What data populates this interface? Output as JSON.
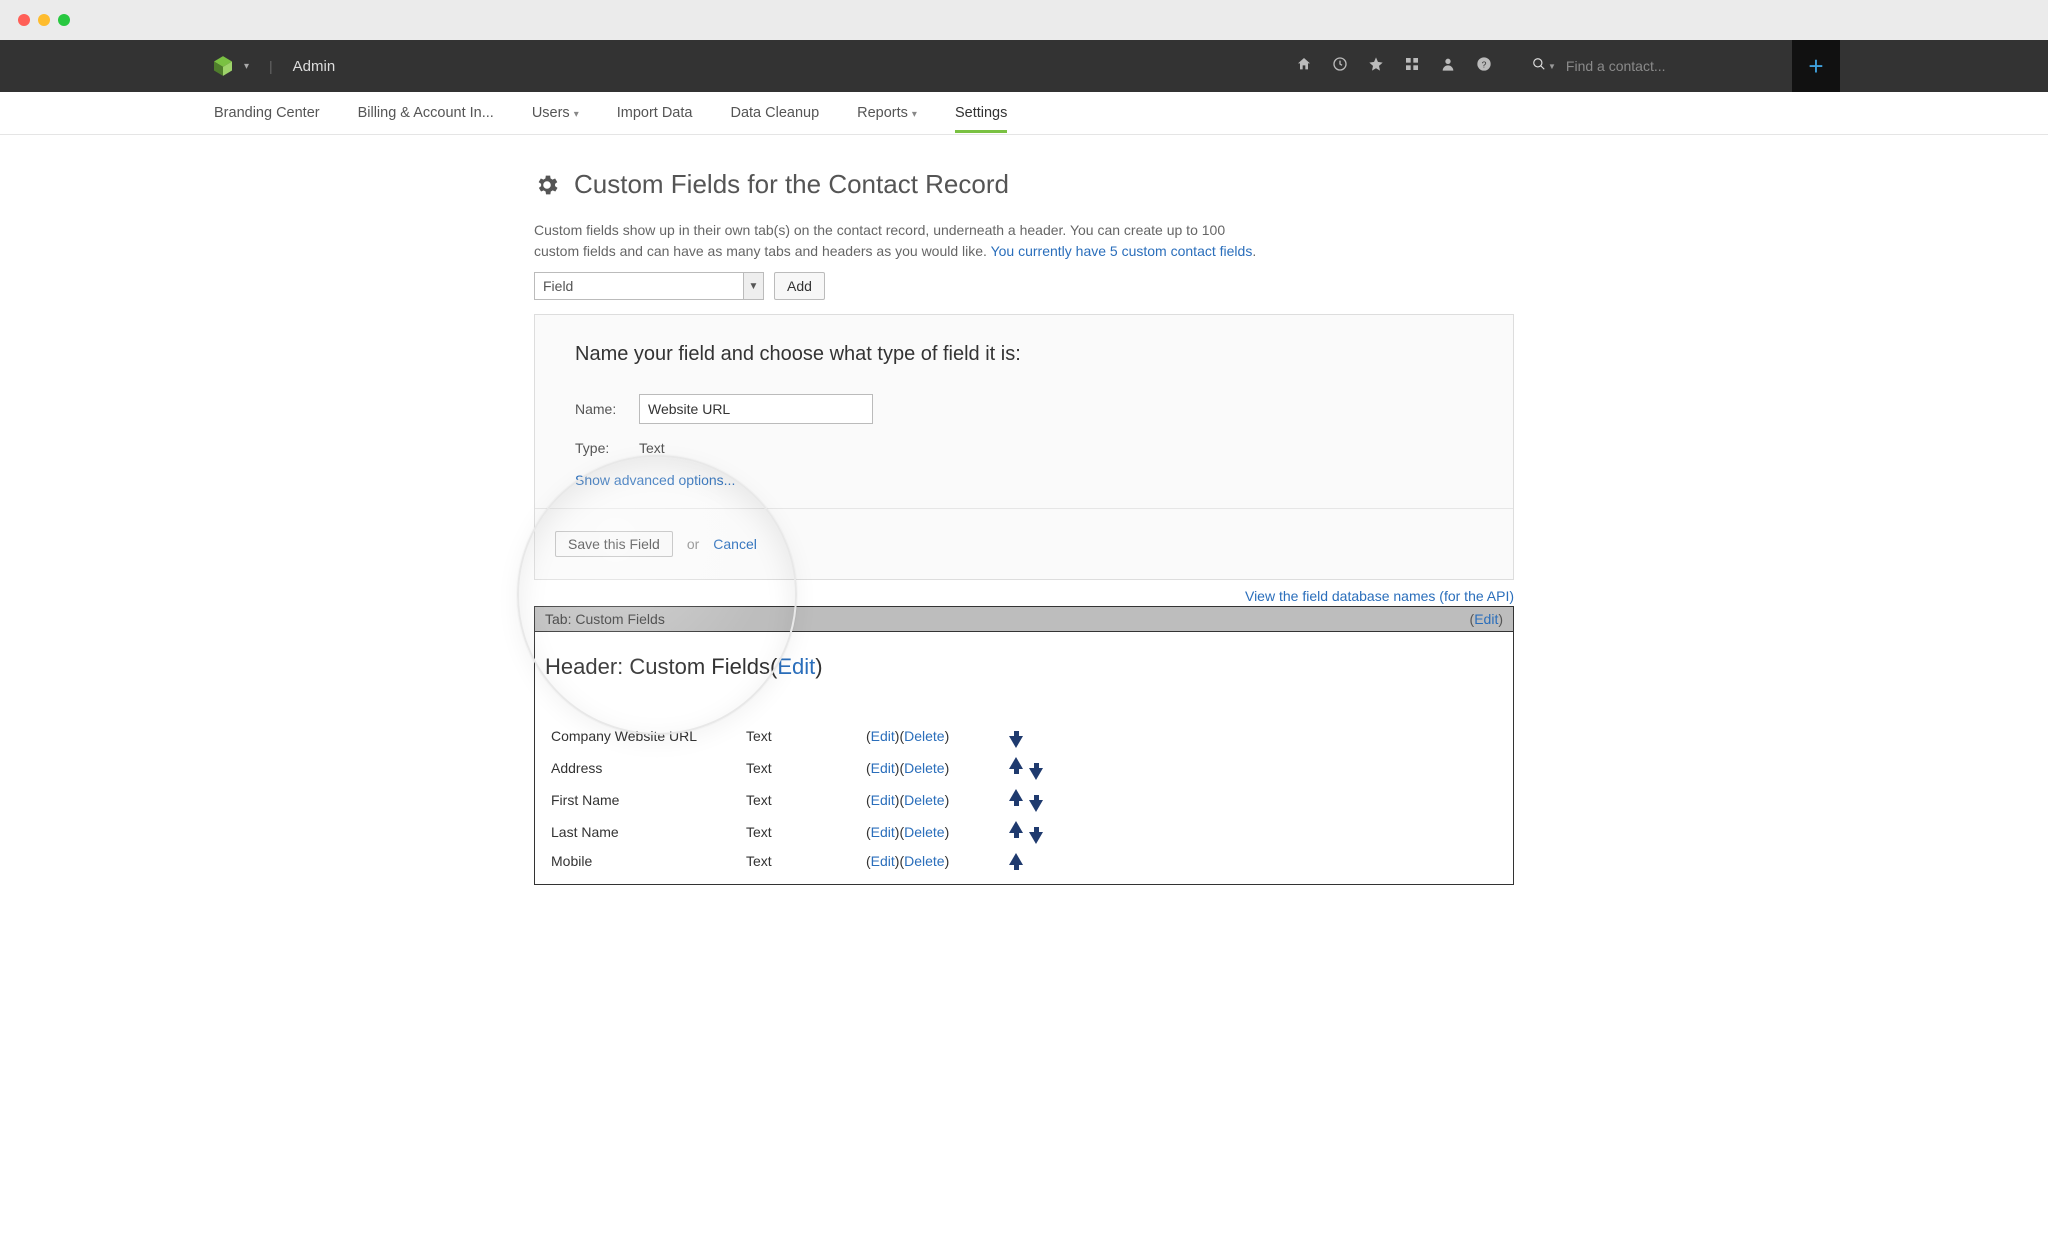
{
  "topbar": {
    "admin_label": "Admin",
    "search_placeholder": "Find a contact..."
  },
  "subnav": {
    "items": [
      {
        "label": "Branding Center"
      },
      {
        "label": "Billing & Account In..."
      },
      {
        "label": "Users",
        "has_caret": true
      },
      {
        "label": "Import Data"
      },
      {
        "label": "Data Cleanup"
      },
      {
        "label": "Reports",
        "has_caret": true
      },
      {
        "label": "Settings",
        "active": true
      }
    ]
  },
  "page": {
    "title": "Custom Fields for the Contact Record",
    "intro_a": "Custom fields show up in their own tab(s) on the contact record, underneath a header. You can create up to 100 custom fields and can have as many tabs and headers as you would like. ",
    "intro_link": "You currently have 5 custom contact fields",
    "intro_dot": ".",
    "adder": {
      "select_value": "Field",
      "add_label": "Add"
    },
    "form": {
      "prompt": "Name your field and choose what type of field it is:",
      "name_label": "Name:",
      "name_value": "Website URL",
      "type_label": "Type:",
      "type_value": "Text",
      "advanced_link": "Show advanced options...",
      "save_label": "Save this Field",
      "or_label": "or",
      "cancel_label": "Cancel"
    },
    "dbnames_link": "View the field database names (for the API)",
    "tabbar": {
      "label": "Tab: Custom Fields",
      "edit": "Edit"
    },
    "header": {
      "prefix": "Header: Custom Fields",
      "edit": "Edit"
    },
    "columns": {
      "edit": "Edit",
      "delete": "Delete"
    },
    "rows": [
      {
        "name": "Company Website URL",
        "type": "Text",
        "up": false,
        "down": true
      },
      {
        "name": "Address",
        "type": "Text",
        "up": true,
        "down": true
      },
      {
        "name": "First Name",
        "type": "Text",
        "up": true,
        "down": true
      },
      {
        "name": "Last Name",
        "type": "Text",
        "up": true,
        "down": true
      },
      {
        "name": "Mobile",
        "type": "Text",
        "up": true,
        "down": false
      }
    ]
  }
}
